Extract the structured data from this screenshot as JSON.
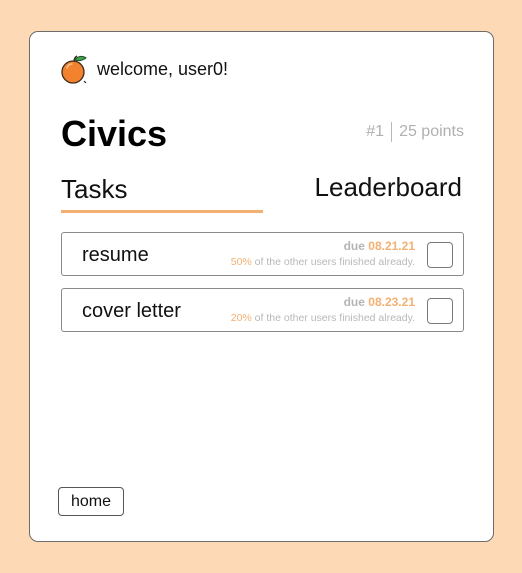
{
  "header": {
    "welcome_text": "welcome, user0!",
    "logo_icon": "orange-fruit-icon"
  },
  "course": {
    "title": "Civics",
    "rank": "#1",
    "points": "25 points"
  },
  "tabs": [
    {
      "label": "Tasks",
      "active": true
    },
    {
      "label": "Leaderboard",
      "active": false
    }
  ],
  "tasks": [
    {
      "name": "resume",
      "due_prefix": "due",
      "due_date": "08.21.21",
      "completion_percent": "50%",
      "completion_suffix": "of the other users finished already.",
      "checked": false
    },
    {
      "name": "cover letter",
      "due_prefix": "due",
      "due_date": "08.23.21",
      "completion_percent": "20%",
      "completion_suffix": "of the other users finished already.",
      "checked": false
    }
  ],
  "footer": {
    "home_label": "home"
  },
  "colors": {
    "background": "#fdd9b5",
    "accent": "#f4b073",
    "muted_text": "#b5b5b5",
    "card": "#ffffff"
  }
}
